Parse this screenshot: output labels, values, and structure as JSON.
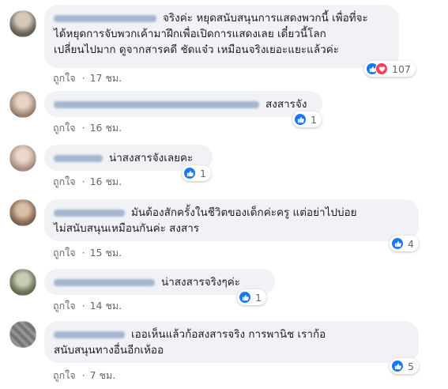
{
  "comments": [
    {
      "text": "จริงค่ะ หยุดสนับสนุนการแสดงพวกนี้ เพื่อที่จะ\nได้หยุดการจับพวกเค้ามาฝึกเพื่อเปิดการแสดงเลย เดี๋ยวนี้โลก\nเปลี่ยนไปมาก ดูจากสารคดี ชัดแจ๋ว เหมือนจริงเยอะแยะแล้วค่ะ",
      "like_label": "ถูกใจ",
      "time": "17 ชม.",
      "reaction_count": "107",
      "reaction_icons": [
        "like-icon",
        "love-icon"
      ],
      "avatar_color": "#6d6a5e"
    },
    {
      "text": "สงสารจัง",
      "like_label": "ถูกใจ",
      "time": "16 ชม.",
      "reaction_count": "1",
      "reaction_icons": [
        "like-icon"
      ],
      "avatar_color": "#a88f7c"
    },
    {
      "text": "น่าสงสารจังเลยคะ",
      "like_label": "ถูกใจ",
      "time": "16 ชม.",
      "reaction_count": "1",
      "reaction_icons": [
        "like-icon"
      ],
      "avatar_color": "#b59a8c"
    },
    {
      "text": "มันต้องสักครั้งในชีวิตของเด็กค่ะครู แต่อย่าไปบ่อย\nไม่สนับสนุนเหมือนกันค่ะ สงสาร",
      "like_label": "ถูกใจ",
      "time": "15 ชม.",
      "reaction_count": "4",
      "reaction_icons": [
        "like-icon"
      ],
      "avatar_color": "#8c6e58"
    },
    {
      "text": "น่าสงสารจริงๆค่ะ",
      "like_label": "ถูกใจ",
      "time": "14 ชม.",
      "reaction_count": "1",
      "reaction_icons": [
        "like-icon"
      ],
      "avatar_color": "#6f7a5d"
    },
    {
      "text": "เออเห็นแล้วก้อสงสารจริง การพานิช เราก้อ\nสนับสนุนทางอื่นอีกเห้ออ",
      "like_label": "ถูกใจ",
      "time": "7 ชม.",
      "reaction_count": "5",
      "reaction_icons": [
        "like-icon"
      ],
      "avatar_color": "#8a8a8a"
    }
  ],
  "colors": {
    "bubble": "#f0f2f5",
    "meta_text": "#65676b",
    "like_blue": "#1877f2",
    "love_red": "#f33e58"
  }
}
